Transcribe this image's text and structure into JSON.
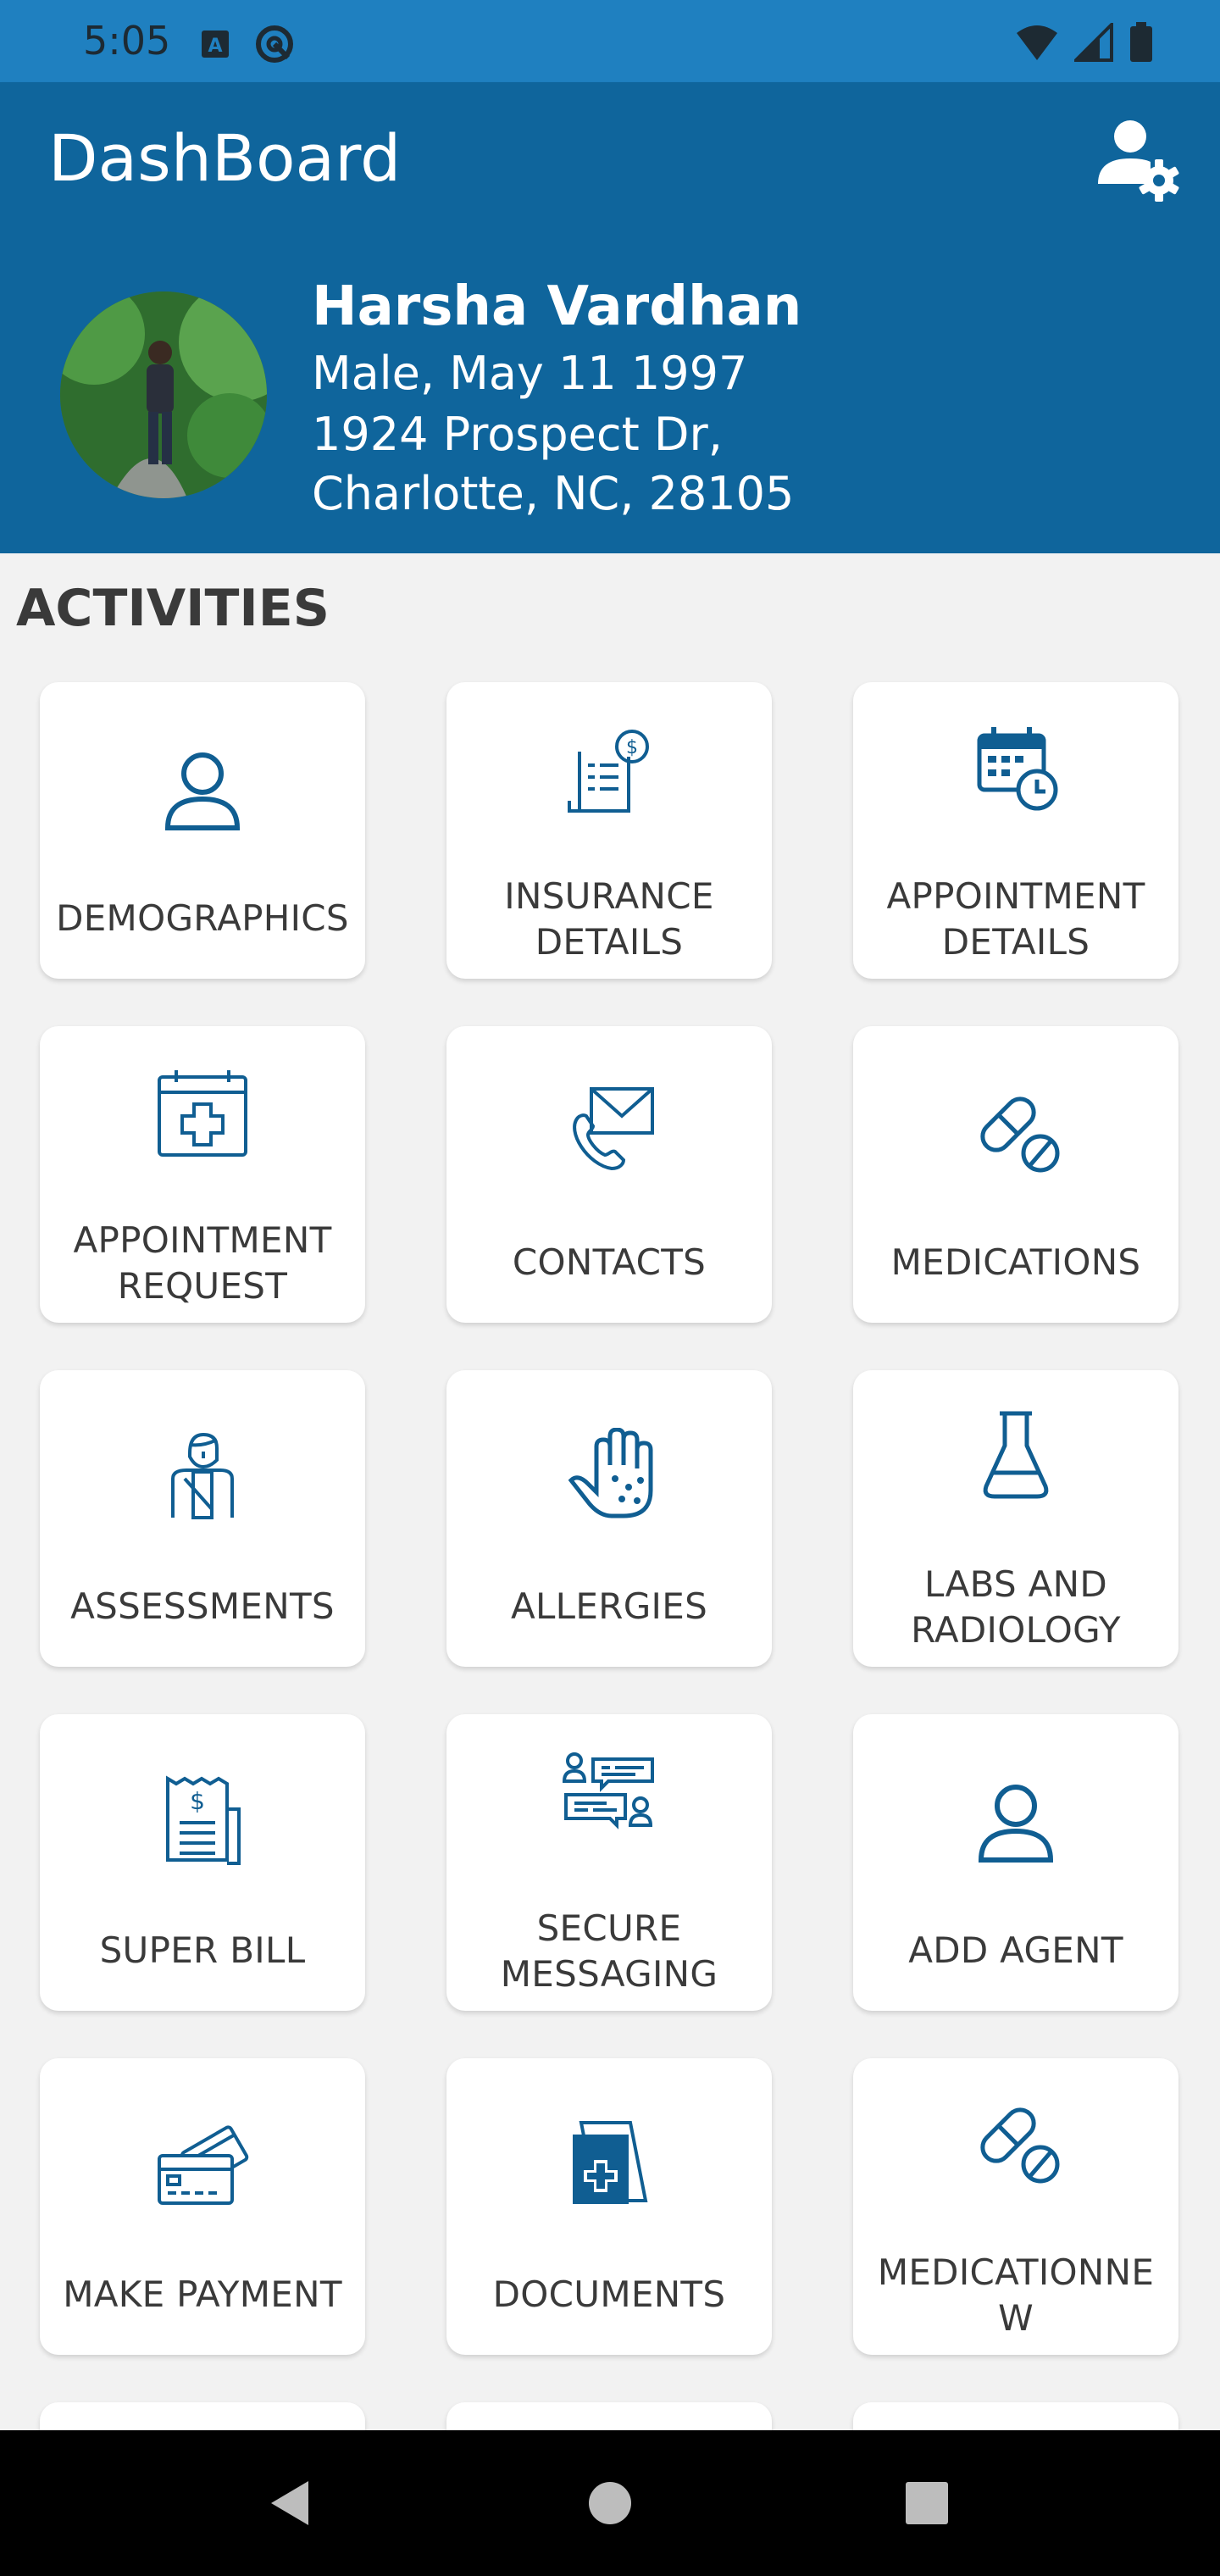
{
  "status_bar": {
    "time": "5:05",
    "icons_left": [
      "a-badge-icon",
      "at-sign-icon"
    ],
    "icons_right": [
      "wifi-icon",
      "cell-signal-icon",
      "battery-icon"
    ]
  },
  "app_bar": {
    "title": "DashBoard",
    "action_icon": "user-settings-icon"
  },
  "profile": {
    "name": "Harsha Vardhan",
    "gender_dob": "Male, May 11 1997",
    "address_line1": "1924 Prospect Dr,",
    "address_line2": "Charlotte, NC, 28105"
  },
  "section_title": "ACTIVITIES",
  "activities": [
    {
      "label_line1": "DEMOGRAPHICS",
      "label_line2": "",
      "icon": "person-icon"
    },
    {
      "label_line1": "INSURANCE",
      "label_line2": "DETAILS",
      "icon": "insurance-bill-icon"
    },
    {
      "label_line1": "APPOINTMENT",
      "label_line2": "DETAILS",
      "icon": "calendar-clock-icon"
    },
    {
      "label_line1": "APPOINTMENT",
      "label_line2": "REQUEST",
      "icon": "calendar-plus-icon"
    },
    {
      "label_line1": "CONTACTS",
      "label_line2": "",
      "icon": "phone-envelope-icon"
    },
    {
      "label_line1": "MEDICATIONS",
      "label_line2": "",
      "icon": "pill-icon"
    },
    {
      "label_line1": "ASSESSMENTS",
      "label_line2": "",
      "icon": "patient-icon"
    },
    {
      "label_line1": "ALLERGIES",
      "label_line2": "",
      "icon": "hand-allergy-icon"
    },
    {
      "label_line1": "LABS AND",
      "label_line2": "RADIOLOGY",
      "icon": "flask-icon"
    },
    {
      "label_line1": "SUPER BILL",
      "label_line2": "",
      "icon": "receipt-icon"
    },
    {
      "label_line1": "SECURE",
      "label_line2": "MESSAGING",
      "icon": "chat-people-icon"
    },
    {
      "label_line1": "ADD AGENT",
      "label_line2": "",
      "icon": "person-icon"
    },
    {
      "label_line1": "MAKE PAYMENT",
      "label_line2": "",
      "icon": "credit-card-icon"
    },
    {
      "label_line1": "DOCUMENTS",
      "label_line2": "",
      "icon": "medical-document-icon"
    },
    {
      "label_line1": "MEDICATIONNE",
      "label_line2": "W",
      "icon": "pill-icon"
    }
  ],
  "nav_bar": {
    "buttons": [
      "back-icon",
      "home-icon",
      "recents-icon"
    ]
  },
  "colors": {
    "status_bar": "#1f80c0",
    "primary": "#0f659c",
    "icon": "#105e92",
    "background": "#f2f2f2"
  }
}
